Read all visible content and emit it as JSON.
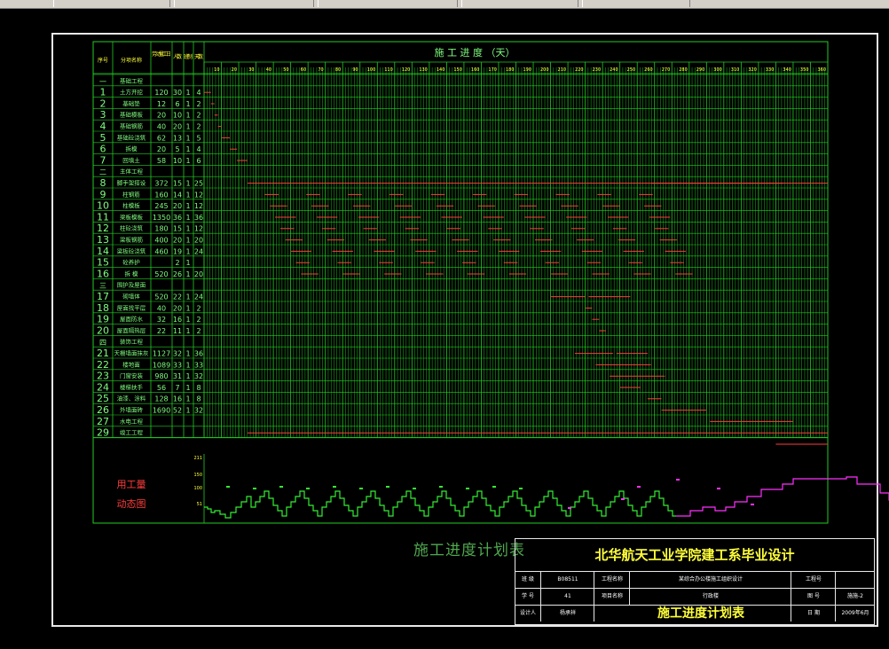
{
  "header": {
    "col_seq": "序号",
    "col_name": "分项名称",
    "col_qty": "劳动量工日",
    "col_people": "人数",
    "col_shift": "班制",
    "col_days": "天数",
    "schedule_title": "施 工 进 度 （天）"
  },
  "timeline_ticks": [
    "10",
    "20",
    "30",
    "40",
    "50",
    "60",
    "70",
    "80",
    "90",
    "100",
    "110",
    "120",
    "130",
    "140",
    "150",
    "160",
    "170",
    "180",
    "190",
    "200",
    "210",
    "220",
    "230",
    "240",
    "250",
    "260",
    "270",
    "280",
    "290",
    "300",
    "310",
    "320",
    "330",
    "340",
    "350",
    "360"
  ],
  "rows": [
    {
      "seq": "一",
      "name": "基础工程",
      "qty": "",
      "people": "",
      "shift": "",
      "days": "",
      "header": true
    },
    {
      "seq": "1",
      "name": "土方开挖",
      "qty": "120",
      "people": "30",
      "shift": "1",
      "days": "4"
    },
    {
      "seq": "2",
      "name": "基础垫",
      "qty": "12",
      "people": "6",
      "shift": "1",
      "days": "2"
    },
    {
      "seq": "3",
      "name": "基础模板",
      "qty": "20",
      "people": "10",
      "shift": "1",
      "days": "2"
    },
    {
      "seq": "4",
      "name": "基础钢筋",
      "qty": "40",
      "people": "20",
      "shift": "1",
      "days": "2"
    },
    {
      "seq": "5",
      "name": "基础砼浇筑",
      "qty": "62",
      "people": "13",
      "shift": "1",
      "days": "5"
    },
    {
      "seq": "6",
      "name": "拆模",
      "qty": "20",
      "people": "5",
      "shift": "1",
      "days": "4"
    },
    {
      "seq": "7",
      "name": "回填土",
      "qty": "58",
      "people": "10",
      "shift": "1",
      "days": "6"
    },
    {
      "seq": "二",
      "name": "主体工程",
      "qty": "",
      "people": "",
      "shift": "",
      "days": "",
      "header": true
    },
    {
      "seq": "8",
      "name": "脚手架搭设",
      "qty": "372",
      "people": "15",
      "shift": "1",
      "days": "25"
    },
    {
      "seq": "9",
      "name": "柱钢筋",
      "qty": "160",
      "people": "14",
      "shift": "1",
      "days": "12"
    },
    {
      "seq": "10",
      "name": "柱模板",
      "qty": "245",
      "people": "20",
      "shift": "1",
      "days": "12"
    },
    {
      "seq": "11",
      "name": "梁板模板",
      "qty": "1350",
      "people": "36",
      "shift": "1",
      "days": "36"
    },
    {
      "seq": "12",
      "name": "柱砼浇筑",
      "qty": "180",
      "people": "15",
      "shift": "1",
      "days": "12"
    },
    {
      "seq": "13",
      "name": "梁板钢筋",
      "qty": "400",
      "people": "20",
      "shift": "1",
      "days": "20"
    },
    {
      "seq": "14",
      "name": "梁板砼浇筑",
      "qty": "460",
      "people": "19",
      "shift": "1",
      "days": "24"
    },
    {
      "seq": "15",
      "name": "砼养护",
      "qty": "",
      "people": "2",
      "shift": "1",
      "days": ""
    },
    {
      "seq": "16",
      "name": "拆 模",
      "qty": "520",
      "people": "26",
      "shift": "1",
      "days": "20"
    },
    {
      "seq": "三",
      "name": "围护及屋面",
      "qty": "",
      "people": "",
      "shift": "",
      "days": "",
      "header": true
    },
    {
      "seq": "17",
      "name": "砌墙体",
      "qty": "520",
      "people": "22",
      "shift": "1",
      "days": "24"
    },
    {
      "seq": "18",
      "name": "屋面找平层",
      "qty": "40",
      "people": "20",
      "shift": "1",
      "days": "2"
    },
    {
      "seq": "19",
      "name": "屋面防水",
      "qty": "32",
      "people": "16",
      "shift": "1",
      "days": "2"
    },
    {
      "seq": "20",
      "name": "屋面隔热层",
      "qty": "22",
      "people": "11",
      "shift": "1",
      "days": "2"
    },
    {
      "seq": "四",
      "name": "装饰工程",
      "qty": "",
      "people": "",
      "shift": "",
      "days": "",
      "header": true
    },
    {
      "seq": "21",
      "name": "天棚墙面抹灰",
      "qty": "1127",
      "people": "32",
      "shift": "1",
      "days": "36"
    },
    {
      "seq": "22",
      "name": "楼地面",
      "qty": "1089",
      "people": "33",
      "shift": "1",
      "days": "33"
    },
    {
      "seq": "23",
      "name": "门窗安装",
      "qty": "980",
      "people": "31",
      "shift": "1",
      "days": "32"
    },
    {
      "seq": "24",
      "name": "楼梯扶手",
      "qty": "56",
      "people": "7",
      "shift": "1",
      "days": "8"
    },
    {
      "seq": "25",
      "name": "油漆、涂料",
      "qty": "128",
      "people": "16",
      "shift": "1",
      "days": "8"
    },
    {
      "seq": "26",
      "name": "外墙面砖",
      "qty": "1690",
      "people": "52",
      "shift": "1",
      "days": "32"
    },
    {
      "seq": "27",
      "name": "水电工程",
      "qty": "",
      "people": "",
      "shift": "",
      "days": ""
    },
    {
      "seq": "29",
      "name": "竣工工程",
      "qty": "",
      "people": "",
      "shift": "",
      "days": ""
    }
  ],
  "labor_chart": {
    "label_line1": "用工量",
    "label_line2": "动态图",
    "y_ticks": [
      "211",
      "150",
      "100",
      "51"
    ]
  },
  "plan_title": "施工进度计划表",
  "title_block": {
    "school": "北华航天工业学院建工系毕业设计",
    "r1": [
      "班 级",
      "B08511",
      "工程名称",
      "某综合办公楼施工组织设计",
      "工程号",
      ""
    ],
    "r2": [
      "学 号",
      "41",
      "项目名称",
      "行政楼",
      "图 号",
      "施施-2"
    ],
    "r3": [
      "设计人",
      "杨承祥",
      "",
      "",
      "日 期",
      "2009年6月"
    ],
    "drawing_name": "施工进度计划表"
  },
  "colors": {
    "grid": "#22cc22",
    "text_green": "#7fff7f",
    "yellow": "#ffff3a",
    "red": "#ff3b3b",
    "magenta": "#ff30ff",
    "white": "#e8e8e8"
  }
}
